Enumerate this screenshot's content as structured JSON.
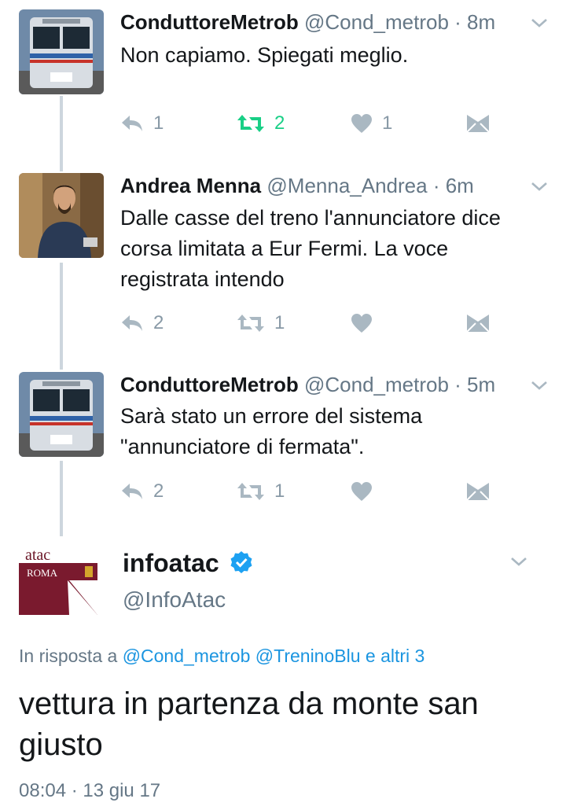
{
  "tweets": [
    {
      "name": "ConduttoreMetrob",
      "handle": "@Cond_metrob",
      "time": "· 8m",
      "text": "Non capiamo. Spiegati meglio.",
      "replies": "1",
      "retweets": "2",
      "likes": "1",
      "retweeted": true
    },
    {
      "name": "Andrea Menna",
      "handle": "@Menna_Andrea",
      "time": "· 6m",
      "text_lines": [
        "Dalle casse del treno l'annunciatore dice",
        "corsa limitata a Eur Fermi. La voce",
        "registrata intendo"
      ],
      "replies": "2",
      "retweets": "1",
      "likes": ""
    },
    {
      "name": "ConduttoreMetrob",
      "handle": "@Cond_metrob",
      "time": "· 5m",
      "text_lines": [
        "Sarà stato un errore del sistema",
        "\"annunciatore di fermata\"."
      ],
      "replies": "2",
      "retweets": "1",
      "likes": ""
    }
  ],
  "main_tweet": {
    "avatar_logo_text": "atac",
    "avatar_city_text": "ROMA",
    "name": "infoatac",
    "verified": true,
    "handle": "@InfoAtac",
    "reply_prefix": "In risposta a",
    "reply_mentions": "@Cond_metrob @TreninoBlu e altri 3",
    "text": "vettura in partenza da monte san giusto",
    "timestamp": "08:04 · 13 giu 17"
  },
  "colors": {
    "retweet_active": "#19cf86",
    "link": "#1b95e0",
    "secondary_text": "#657786",
    "icon_gray": "#aab8c2",
    "verified_blue": "#1da1f2",
    "atac_maroon": "#7a1a2e"
  },
  "icons": [
    "reply-icon",
    "retweet-icon",
    "like-icon",
    "dm-icon",
    "chevron-down-icon",
    "verified-badge-icon"
  ]
}
